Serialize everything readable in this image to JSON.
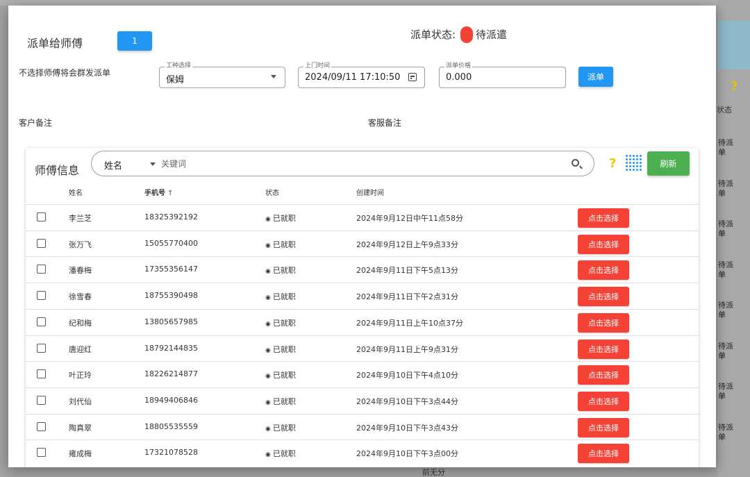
{
  "background": {
    "column_header": "状态",
    "status_cells": [
      "待派\n单",
      "待派\n单",
      "待派\n单",
      "待派\n单",
      "待派\n单",
      "待派\n单",
      "待派\n单",
      "待派\n单"
    ],
    "bottom_text": "前无分"
  },
  "dialog": {
    "title": "派单给师傅",
    "count": "1",
    "status_label": "派单状态:",
    "status_value": "待派遣",
    "hint": "不选择师傅将会群发派单",
    "job_type": {
      "legend": "工种选择",
      "value": "保姆"
    },
    "visit_time": {
      "legend": "上门时间",
      "value": "2024/09/11 17:10:50"
    },
    "price": {
      "legend": "派单价格",
      "value": "0.000"
    },
    "dispatch_label": "派单",
    "customer_note_label": "客户备注",
    "service_note_label": "客服备注"
  },
  "workers": {
    "title": "师傅信息",
    "search_field": "姓名",
    "search_placeholder": "关键词",
    "refresh_label": "刷新",
    "columns": {
      "name": "姓名",
      "phone": "手机号",
      "status": "状态",
      "created": "创建时间"
    },
    "select_label": "点击选择",
    "rows": [
      {
        "name": "李兰芝",
        "phone": "18325392192",
        "status": "已就职",
        "created": "2024年9月12日中午11点58分"
      },
      {
        "name": "张万飞",
        "phone": "15055770400",
        "status": "已就职",
        "created": "2024年9月12日上午9点33分"
      },
      {
        "name": "潘春梅",
        "phone": "17355356147",
        "status": "已就职",
        "created": "2024年9月11日下午5点13分"
      },
      {
        "name": "徐雪春",
        "phone": "18755390498",
        "status": "已就职",
        "created": "2024年9月11日下午2点31分"
      },
      {
        "name": "纪和梅",
        "phone": "13805657985",
        "status": "已就职",
        "created": "2024年9月11日上午10点37分"
      },
      {
        "name": "唐迎红",
        "phone": "18792144835",
        "status": "已就职",
        "created": "2024年9月11日上午9点31分"
      },
      {
        "name": "叶正玲",
        "phone": "18226214877",
        "status": "已就职",
        "created": "2024年9月10日下午4点10分"
      },
      {
        "name": "刘代仙",
        "phone": "18949406846",
        "status": "已就职",
        "created": "2024年9月10日下午3点44分"
      },
      {
        "name": "陶真翠",
        "phone": "18805535559",
        "status": "已就职",
        "created": "2024年9月10日下午3点43分"
      },
      {
        "name": "雍成梅",
        "phone": "17321078528",
        "status": "已就职",
        "created": "2024年9月10日下午3点00分"
      }
    ]
  },
  "colors": {
    "primary": "#2196f3",
    "danger": "#f44336",
    "success": "#4caf50",
    "help": "#f2c800"
  }
}
